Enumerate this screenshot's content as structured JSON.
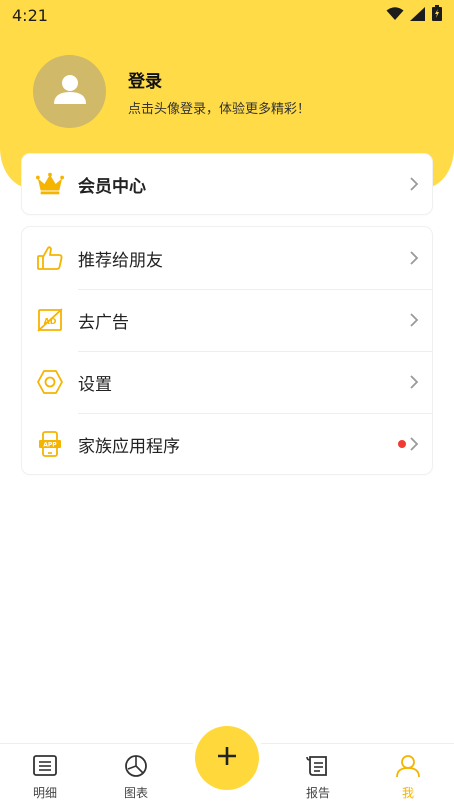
{
  "status_bar": {
    "time": "4:21"
  },
  "profile": {
    "title": "登录",
    "subtitle": "点击头像登录，体验更多精彩！"
  },
  "vip": {
    "label": "会员中心"
  },
  "menu": {
    "items": [
      {
        "label": "推荐给朋友",
        "icon": "thumbs-up-icon"
      },
      {
        "label": "去广告",
        "icon": "no-ad-icon"
      },
      {
        "label": "设置",
        "icon": "settings-hexagon-icon"
      },
      {
        "label": "家族应用程序",
        "icon": "app-phone-icon",
        "badge": "new-dot"
      }
    ]
  },
  "tabbar": {
    "tabs": [
      {
        "label": "明细",
        "icon": "list-icon"
      },
      {
        "label": "图表",
        "icon": "pie-chart-icon"
      },
      {
        "label": "报告",
        "icon": "report-scroll-icon"
      },
      {
        "label": "我",
        "icon": "person-icon",
        "active": true
      }
    ],
    "fab_icon": "plus-icon"
  },
  "colors": {
    "accent": "#ffdb47",
    "active_tab": "#f5b400",
    "icon_outline": "#f5b400",
    "badge": "#f03a32"
  }
}
